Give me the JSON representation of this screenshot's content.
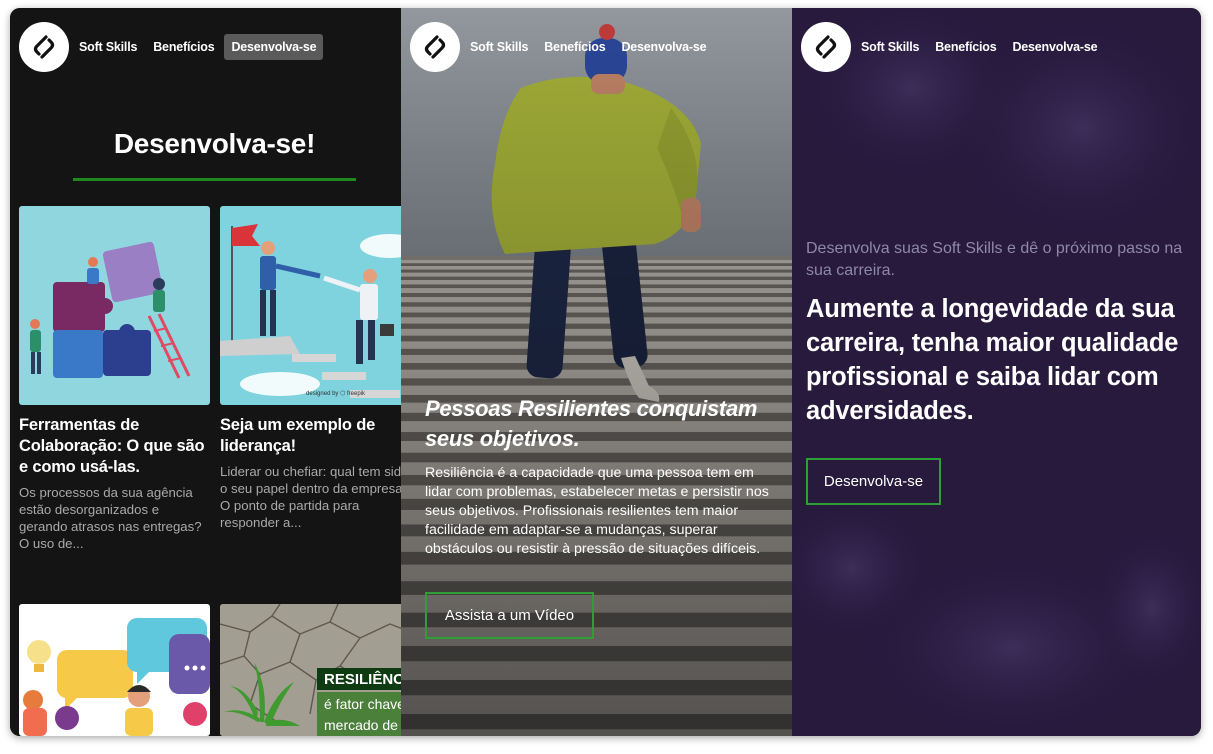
{
  "nav": {
    "items": [
      {
        "label": "Soft Skills"
      },
      {
        "label": "Benefícios"
      },
      {
        "label": "Desenvolva-se"
      }
    ]
  },
  "panel1": {
    "heading": "Desenvolva-se!",
    "cards": [
      {
        "title": "Ferramentas de Colaboração: O que são e como usá-las.",
        "excerpt": "Os processos da sua agência estão desorganizados e gerando atrasos nas entregas? O uso de..."
      },
      {
        "title": "Seja um exemplo de liderança!",
        "excerpt": "Liderar ou chefiar: qual tem sido o seu papel dentro da empresa? O ponto de partida para responder a...",
        "image_credit": "designed by ⬡ freepik"
      },
      {
        "title": "",
        "excerpt": ""
      },
      {
        "title": "",
        "excerpt": "",
        "image_text_1": "RESILIÊNCI",
        "image_text_2": "é fator chave",
        "image_text_3": "mercado de"
      }
    ]
  },
  "panel2": {
    "title": "Pessoas Resilientes conquistam seus objetivos.",
    "body": "Resiliência é a capacidade que uma pessoa tem em lidar com problemas, estabelecer metas e persistir nos seus objetivos. Profissionais resilientes tem maior facilidade em adaptar-se a mudanças, superar obstáculos ou resistir à pressão de situações difíceis.",
    "button": "Assista a um Vídeo"
  },
  "panel3": {
    "subtitle": "Desenvolva suas Soft Skills e dê o próximo passo na sua carreira.",
    "headline": "Aumente a longevidade da sua carreira, tenha maior qualidade profissional e saiba lidar com adversidades",
    "headline_end": ".",
    "button": "Desenvolva-se"
  },
  "colors": {
    "accent_green": "#2e9e36",
    "underline_green": "#1e8a1e",
    "dark_bg": "#141414",
    "purple_bg": "#2a1b40"
  },
  "icons": [
    "logo-icon"
  ]
}
